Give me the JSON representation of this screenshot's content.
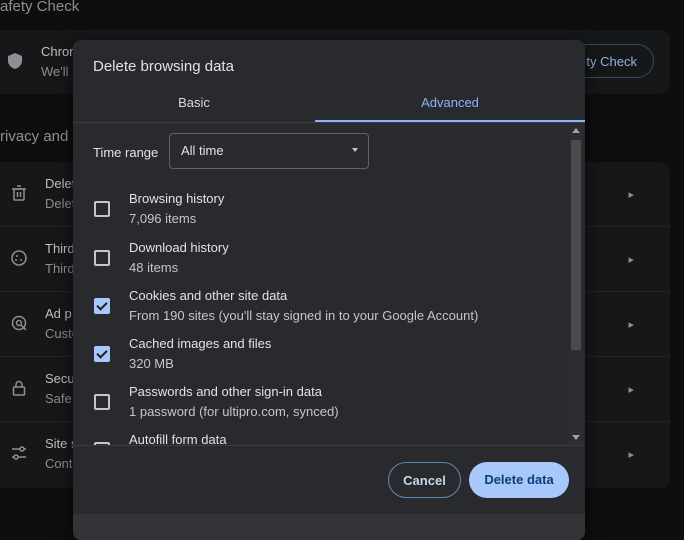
{
  "background": {
    "safety_heading": "afety Check",
    "safety_card": {
      "line1": "Chron",
      "line2": "We'll",
      "button": "ty Check"
    },
    "privacy_heading": "rivacy and s",
    "rows": [
      {
        "icon": "trash-icon",
        "line1": "Delet",
        "line2": "Delet"
      },
      {
        "icon": "cookie-icon",
        "line1": "Third",
        "line2": "Third"
      },
      {
        "icon": "ad-privacy-icon",
        "line1": "Ad p",
        "line2": "Custo"
      },
      {
        "icon": "lock-icon",
        "line1": "Secu",
        "line2": "Safe"
      },
      {
        "icon": "tune-icon",
        "line1": "Site s",
        "line2": "Cont"
      }
    ]
  },
  "dialog": {
    "title": "Delete browsing data",
    "tabs": [
      {
        "label": "Basic"
      },
      {
        "label": "Advanced"
      }
    ],
    "active_tab": "Advanced",
    "time_range": {
      "label": "Time range",
      "value": "All time"
    },
    "items": [
      {
        "title": "Browsing history",
        "subtitle": "7,096 items",
        "checked": false
      },
      {
        "title": "Download history",
        "subtitle": "48 items",
        "checked": false
      },
      {
        "title": "Cookies and other site data",
        "subtitle": "From 190 sites (you'll stay signed in to your Google Account)",
        "checked": true
      },
      {
        "title": "Cached images and files",
        "subtitle": "320 MB",
        "checked": true
      },
      {
        "title": "Passwords and other sign-in data",
        "subtitle": "1 password (for ultipro.com, synced)",
        "checked": false
      },
      {
        "title": "Autofill form data",
        "subtitle": "",
        "checked": false
      }
    ],
    "cancel_label": "Cancel",
    "delete_label": "Delete data"
  },
  "colors": {
    "accent": "#8ab4f8",
    "checkbox_checked": "#a8c7fa",
    "dialog_bg": "#292a2d"
  }
}
